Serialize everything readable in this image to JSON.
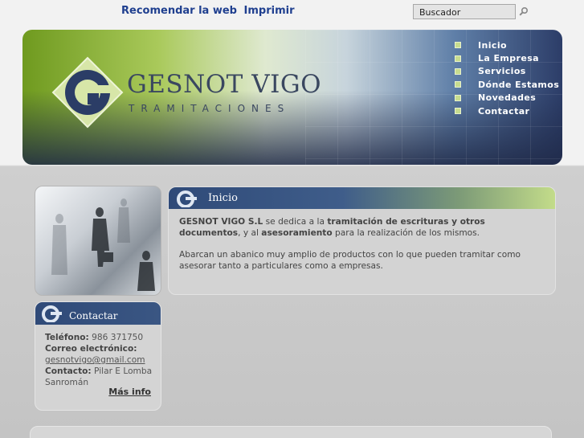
{
  "toplinks": {
    "recommend": "Recomendar la web",
    "print": "Imprimir"
  },
  "search": {
    "value": "Buscador"
  },
  "logo": {
    "title": "GESNOT VIGO",
    "subtitle": "TRAMITACIONES"
  },
  "nav": [
    {
      "label": "Inicio"
    },
    {
      "label": "La Empresa"
    },
    {
      "label": "Servicios"
    },
    {
      "label": "Dónde Estamos"
    },
    {
      "label": "Novedades"
    },
    {
      "label": "Contactar"
    }
  ],
  "main": {
    "title": "Inicio",
    "p1": {
      "company": "GESNOT VIGO S.L",
      "t1": " se dedica a la ",
      "b1": "tramitación de escrituras y otros documentos",
      "t2": ", y al ",
      "b2": "asesoramiento",
      "t3": " para la realización de los mismos."
    },
    "p2": "Abarcan un abanico muy amplio de productos con lo que pueden tramitar como asesorar  tanto a particulares como a empresas."
  },
  "contact": {
    "title": "Contactar",
    "phone_label": "Teléfono:",
    "phone": " 986 371750",
    "email_label": "Correo electrónico:",
    "email": "gesnotvigo@gmail.com",
    "contact_label": "Contacto:",
    "contact_name": " Pilar E Lomba Sanromán",
    "more": "Más info"
  },
  "colors": {
    "accent": "#1f3f8f",
    "header_blue": "#2f4a78",
    "header_green": "#c3dc8a"
  }
}
